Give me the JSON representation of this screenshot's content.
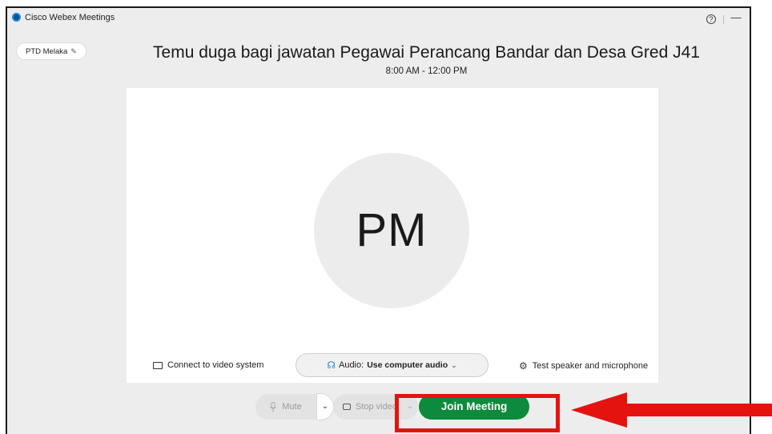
{
  "app": {
    "title": "Cisco Webex Meetings"
  },
  "window": {
    "help_glyph": "?",
    "minimize_glyph": "—"
  },
  "site": {
    "label": "PTD Melaka"
  },
  "meeting": {
    "title": "Temu duga bagi jawatan Pegawai Perancang Bandar dan Desa Gred J41",
    "time": "8:00 AM - 12:00 PM",
    "avatar_initials": "PM"
  },
  "options": {
    "connect_video": "Connect to video system",
    "audio_prefix": "Audio:",
    "audio_value": "Use computer audio",
    "test_speaker": "Test speaker and microphone"
  },
  "controls": {
    "mute_label": "Mute",
    "video_label": "Stop video",
    "join_label": "Join Meeting"
  },
  "colors": {
    "join": "#0e8a3c",
    "highlight": "#e5130f",
    "brand": "#1c8ad9"
  },
  "icons": [
    "webex-logo-icon",
    "help-icon",
    "minimize-icon",
    "pencil-icon",
    "cast-icon",
    "audio-icon",
    "gear-icon",
    "microphone-icon",
    "video-camera-icon",
    "chevron-down-icon",
    "arrow-left-icon"
  ]
}
